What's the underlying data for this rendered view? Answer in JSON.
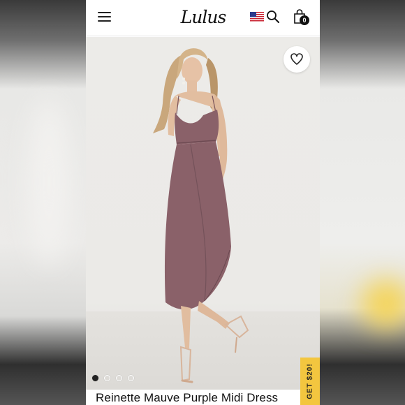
{
  "header": {
    "logo_text": "Lulus",
    "cart_count": "0",
    "icons": [
      "hamburger-menu-icon",
      "us-flag-icon",
      "search-icon",
      "shopping-bag-icon"
    ]
  },
  "product": {
    "title": "Reinette Mauve Purple Midi Dress",
    "dress_color": "#8a6169"
  },
  "gallery": {
    "image_count": 4,
    "active_index": 0
  },
  "promo": {
    "label": "GET $20!"
  },
  "colors": {
    "promo_bg": "#f3c63f",
    "text": "#111111"
  }
}
